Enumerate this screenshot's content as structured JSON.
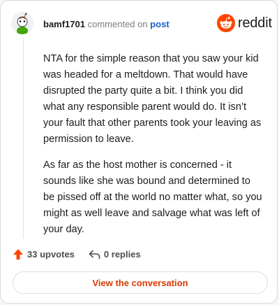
{
  "header": {
    "username": "bamf1701",
    "commented_text": "commented on",
    "post_link": "post",
    "logo_text": "reddit",
    "logo_icon": "reddit-alien-icon"
  },
  "comment": {
    "paragraphs": [
      "NTA for the simple reason that you saw your kid was headed for a meltdown. That would have disrupted the party quite a bit. I think you did what any responsible parent would do. It isn’t your fault that other parents took your leaving as permission to leave.",
      "As far as the host mother is concerned - it sounds like she was bound and determined to be pissed off at the world no matter what, so you might as well leave and salvage what was left of your day."
    ]
  },
  "actions": {
    "upvotes": "33 upvotes",
    "replies": "0 replies"
  },
  "button": {
    "label": "View the conversation"
  },
  "colors": {
    "brand": "#ff4500",
    "link": "#1660c7",
    "button_text": "#d93a00"
  }
}
